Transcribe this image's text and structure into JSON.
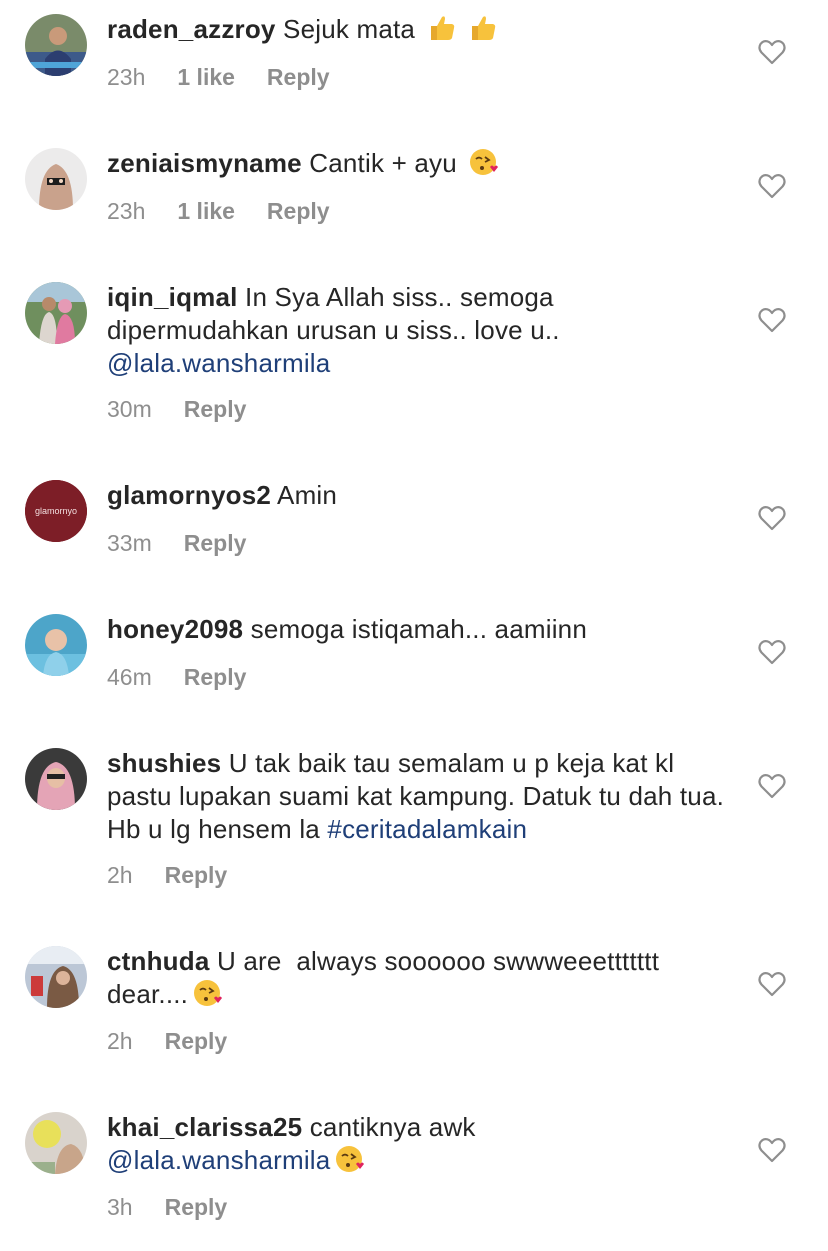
{
  "comments": [
    {
      "username": "raden_azzroy",
      "text": "Sejuk mata",
      "mention": "",
      "emoji": [
        "thumbs-up",
        "thumbs-up"
      ],
      "time": "23h",
      "likes": "1 like",
      "reply": "Reply"
    },
    {
      "username": "zeniaismyname",
      "text": "Cantik + ayu",
      "mention": "",
      "emoji": [
        "kissing-heart"
      ],
      "time": "23h",
      "likes": "1 like",
      "reply": "Reply"
    },
    {
      "username": "iqin_iqmal",
      "text": "In Sya Allah siss.. semoga dipermudahkan urusan u siss.. love u..",
      "mention": "@lala.wansharmila",
      "emoji": [],
      "time": "30m",
      "likes": "",
      "reply": "Reply"
    },
    {
      "username": "glamornyos2",
      "text": "Amin",
      "mention": "",
      "emoji": [],
      "time": "33m",
      "likes": "",
      "reply": "Reply",
      "avatar_text": "glamornyo"
    },
    {
      "username": "honey2098",
      "text": "semoga istiqamah... aamiinn",
      "mention": "",
      "emoji": [],
      "time": "46m",
      "likes": "",
      "reply": "Reply"
    },
    {
      "username": "shushies",
      "text": "U tak baik tau semalam u p keja kat kl pastu lupakan suami kat kampung. Datuk tu dah tua. Hb u lg hensem la",
      "mention": "#ceritadalamkain",
      "emoji": [],
      "time": "2h",
      "likes": "",
      "reply": "Reply"
    },
    {
      "username": "ctnhuda",
      "text": "U are  always soooooo swwweeettttttt dear....",
      "mention": "",
      "emoji": [
        "kissing-heart"
      ],
      "time": "2h",
      "likes": "",
      "reply": "Reply"
    },
    {
      "username": "khai_clarissa25",
      "text": "cantiknya awk",
      "mention": "@lala.wansharmila",
      "emoji": [
        "kissing-heart"
      ],
      "time": "3h",
      "likes": "",
      "reply": "Reply"
    }
  ],
  "colors": {
    "text": "#262626",
    "meta": "#8e8e8e",
    "link": "#1f3f78",
    "heart_outline": "#8e8e8e"
  },
  "icons": {
    "like": "heart-outline-icon"
  }
}
